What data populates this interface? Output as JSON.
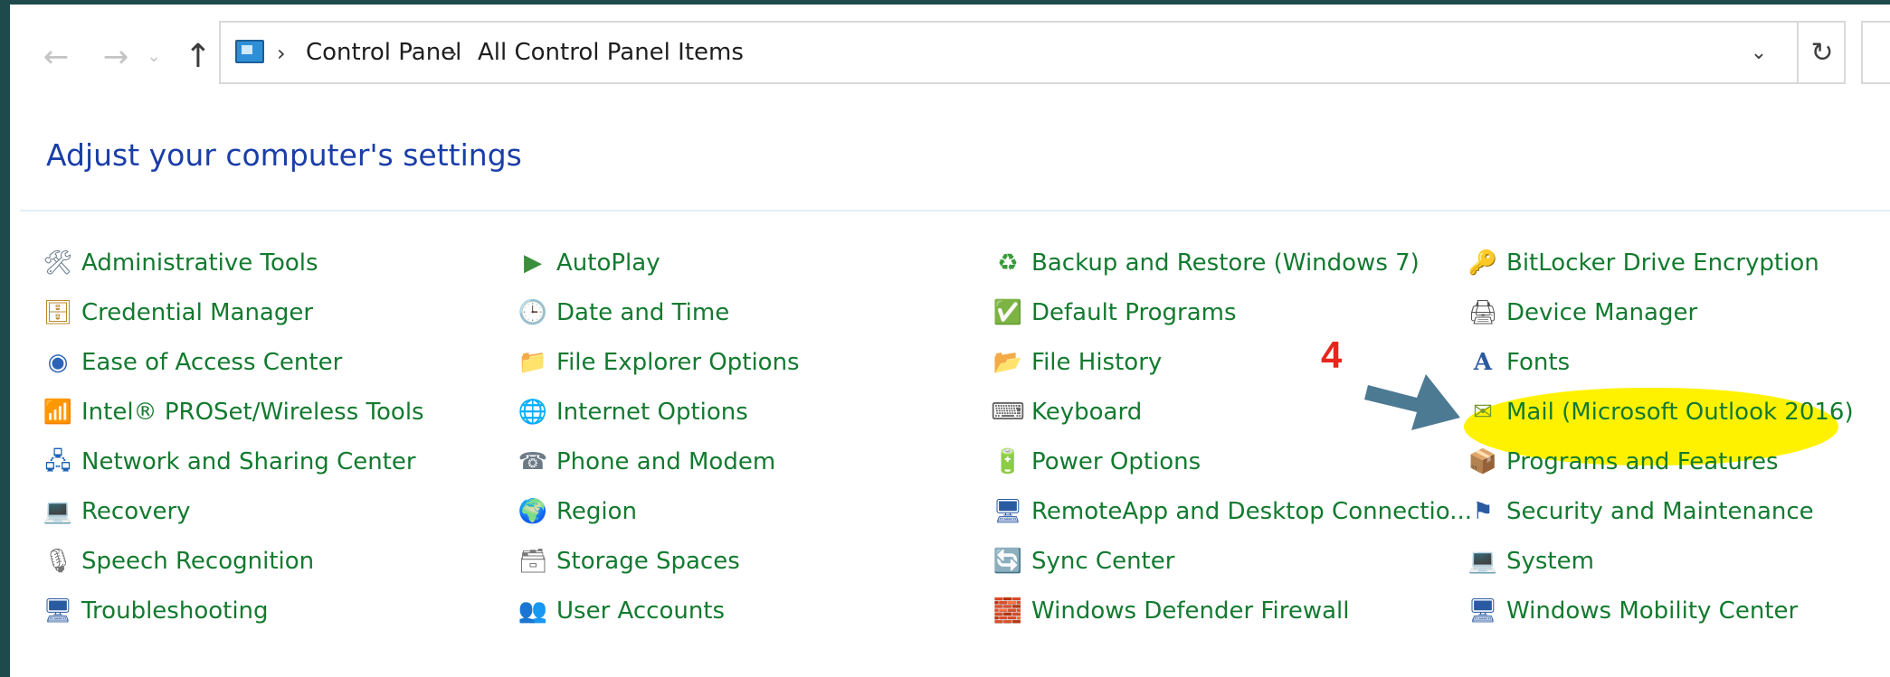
{
  "breadcrumb": [
    "Control Panel",
    "All Control Panel Items"
  ],
  "heading": "Adjust your computer's settings",
  "annotation": {
    "step_number": "4",
    "highlight_color": "#fff200",
    "number_color": "#e8261c",
    "arrow_color": "#4d7a93"
  },
  "colors": {
    "link": "#137a2f",
    "heading": "#1a3ea8",
    "backdrop": "#1f4a4c"
  },
  "columns": [
    [
      {
        "label": "Administrative Tools",
        "icon": "admin-tools-icon",
        "glyph": "🛠"
      },
      {
        "label": "Credential Manager",
        "icon": "credential-manager-icon",
        "glyph": "🗄"
      },
      {
        "label": "Ease of Access Center",
        "icon": "ease-of-access-icon",
        "glyph": "◉"
      },
      {
        "label": "Intel® PROSet/Wireless Tools",
        "icon": "wireless-icon",
        "glyph": "📶"
      },
      {
        "label": "Network and Sharing Center",
        "icon": "network-icon",
        "glyph": "🖧"
      },
      {
        "label": "Recovery",
        "icon": "recovery-icon",
        "glyph": "💻"
      },
      {
        "label": "Speech Recognition",
        "icon": "microphone-icon",
        "glyph": "🎙"
      },
      {
        "label": "Troubleshooting",
        "icon": "troubleshooting-icon",
        "glyph": "🖥"
      }
    ],
    [
      {
        "label": "AutoPlay",
        "icon": "autoplay-icon",
        "glyph": "▶"
      },
      {
        "label": "Date and Time",
        "icon": "clock-icon",
        "glyph": "🕒"
      },
      {
        "label": "File Explorer Options",
        "icon": "folder-options-icon",
        "glyph": "📁"
      },
      {
        "label": "Internet Options",
        "icon": "globe-icon",
        "glyph": "🌐"
      },
      {
        "label": "Phone and Modem",
        "icon": "phone-icon",
        "glyph": "☎"
      },
      {
        "label": "Region",
        "icon": "region-icon",
        "glyph": "🌍"
      },
      {
        "label": "Storage Spaces",
        "icon": "storage-icon",
        "glyph": "🗃"
      },
      {
        "label": "User Accounts",
        "icon": "users-icon",
        "glyph": "👥"
      }
    ],
    [
      {
        "label": "Backup and Restore (Windows 7)",
        "icon": "backup-icon",
        "glyph": "♻"
      },
      {
        "label": "Default Programs",
        "icon": "default-programs-icon",
        "glyph": "✅"
      },
      {
        "label": "File History",
        "icon": "file-history-icon",
        "glyph": "📂"
      },
      {
        "label": "Keyboard",
        "icon": "keyboard-icon",
        "glyph": "⌨"
      },
      {
        "label": "Power Options",
        "icon": "power-icon",
        "glyph": "🔋"
      },
      {
        "label": "RemoteApp and Desktop Connectio...",
        "icon": "remoteapp-icon",
        "glyph": "🖥"
      },
      {
        "label": "Sync Center",
        "icon": "sync-icon",
        "glyph": "🔄"
      },
      {
        "label": "Windows Defender Firewall",
        "icon": "firewall-icon",
        "glyph": "🧱"
      }
    ],
    [
      {
        "label": "BitLocker Drive Encryption",
        "icon": "bitlocker-icon",
        "glyph": "🔑"
      },
      {
        "label": "Device Manager",
        "icon": "device-manager-icon",
        "glyph": "🖨"
      },
      {
        "label": "Fonts",
        "icon": "fonts-icon",
        "glyph": "A"
      },
      {
        "label": "Mail (Microsoft Outlook 2016)",
        "icon": "mail-icon",
        "glyph": "✉"
      },
      {
        "label": "Programs and Features",
        "icon": "programs-icon",
        "glyph": "📦"
      },
      {
        "label": "Security and Maintenance",
        "icon": "flag-icon",
        "glyph": "⚑"
      },
      {
        "label": "System",
        "icon": "system-icon",
        "glyph": "💻"
      },
      {
        "label": "Windows Mobility Center",
        "icon": "mobility-icon",
        "glyph": "🖥"
      }
    ]
  ]
}
